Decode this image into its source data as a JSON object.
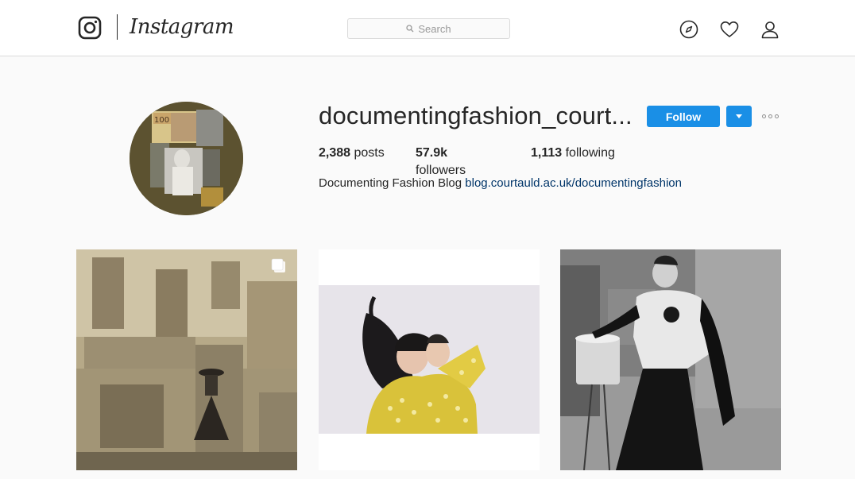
{
  "header": {
    "brand": "Instagram",
    "search_placeholder": "Search",
    "icons": [
      "instagram-camera-icon",
      "search-icon",
      "explore-compass-icon",
      "heart-icon",
      "user-icon"
    ]
  },
  "profile": {
    "username": "documentingfashion_court...",
    "follow_label": "Follow",
    "stats": {
      "posts_count": "2,388",
      "posts_label": "posts",
      "followers_count": "57.9k",
      "followers_label": "followers",
      "following_count": "1,113",
      "following_label": "following"
    },
    "bio_text": "Documenting Fashion Blog",
    "bio_link": "blog.courtauld.ac.uk/documentingfashion"
  },
  "colors": {
    "accent": "#1a8fe6",
    "link": "#003569",
    "background": "#fafafa"
  },
  "posts": [
    {
      "icon": "multiple-images-icon"
    },
    {},
    {}
  ]
}
